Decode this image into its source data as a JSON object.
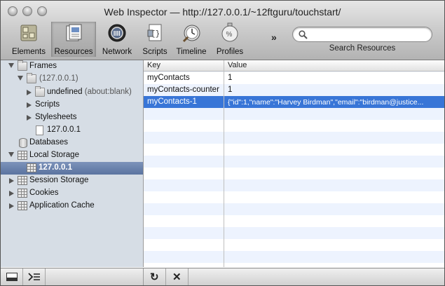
{
  "window": {
    "title": "Web Inspector — http://127.0.0.1/~12ftguru/touchstart/"
  },
  "toolbar": {
    "buttons": [
      {
        "label": "Elements",
        "icon": "elements-icon"
      },
      {
        "label": "Resources",
        "icon": "resources-icon",
        "selected": true
      },
      {
        "label": "Network",
        "icon": "network-icon"
      },
      {
        "label": "Scripts",
        "icon": "scripts-icon"
      },
      {
        "label": "Timeline",
        "icon": "timeline-icon"
      },
      {
        "label": "Profiles",
        "icon": "profiles-icon"
      }
    ],
    "overflow_label": "»",
    "search_placeholder": "",
    "search_caption": "Search Resources"
  },
  "sidebar": {
    "frames_label": "Frames",
    "frame_host": "(127.0.0.1)",
    "undefined_label": "undefined",
    "undefined_suffix": "(about:blank)",
    "scripts_label": "Scripts",
    "stylesheets_label": "Stylesheets",
    "doc_label": "127.0.0.1",
    "databases_label": "Databases",
    "local_storage_label": "Local Storage",
    "local_storage_item": "127.0.0.1",
    "session_storage_label": "Session Storage",
    "cookies_label": "Cookies",
    "app_cache_label": "Application Cache"
  },
  "table": {
    "columns": [
      "Key",
      "Value"
    ],
    "rows": [
      {
        "key": "myContacts",
        "value": "1"
      },
      {
        "key": "myContacts-counter",
        "value": "1"
      },
      {
        "key": "myContacts-1",
        "value": "{\"id\":1,\"name\":\"Harvey Birdman\",\"email\":\"birdman@justice...",
        "selected": true
      }
    ]
  },
  "statusbar": {
    "dock_icon": "dock-icon",
    "console_icon": "console-icon",
    "refresh_label": "↻",
    "delete_label": "✕"
  },
  "colors": {
    "selection_blue": "#3875d7",
    "sidebar_bg": "#d6dde5",
    "sidebar_selection": "#6b82ad"
  }
}
